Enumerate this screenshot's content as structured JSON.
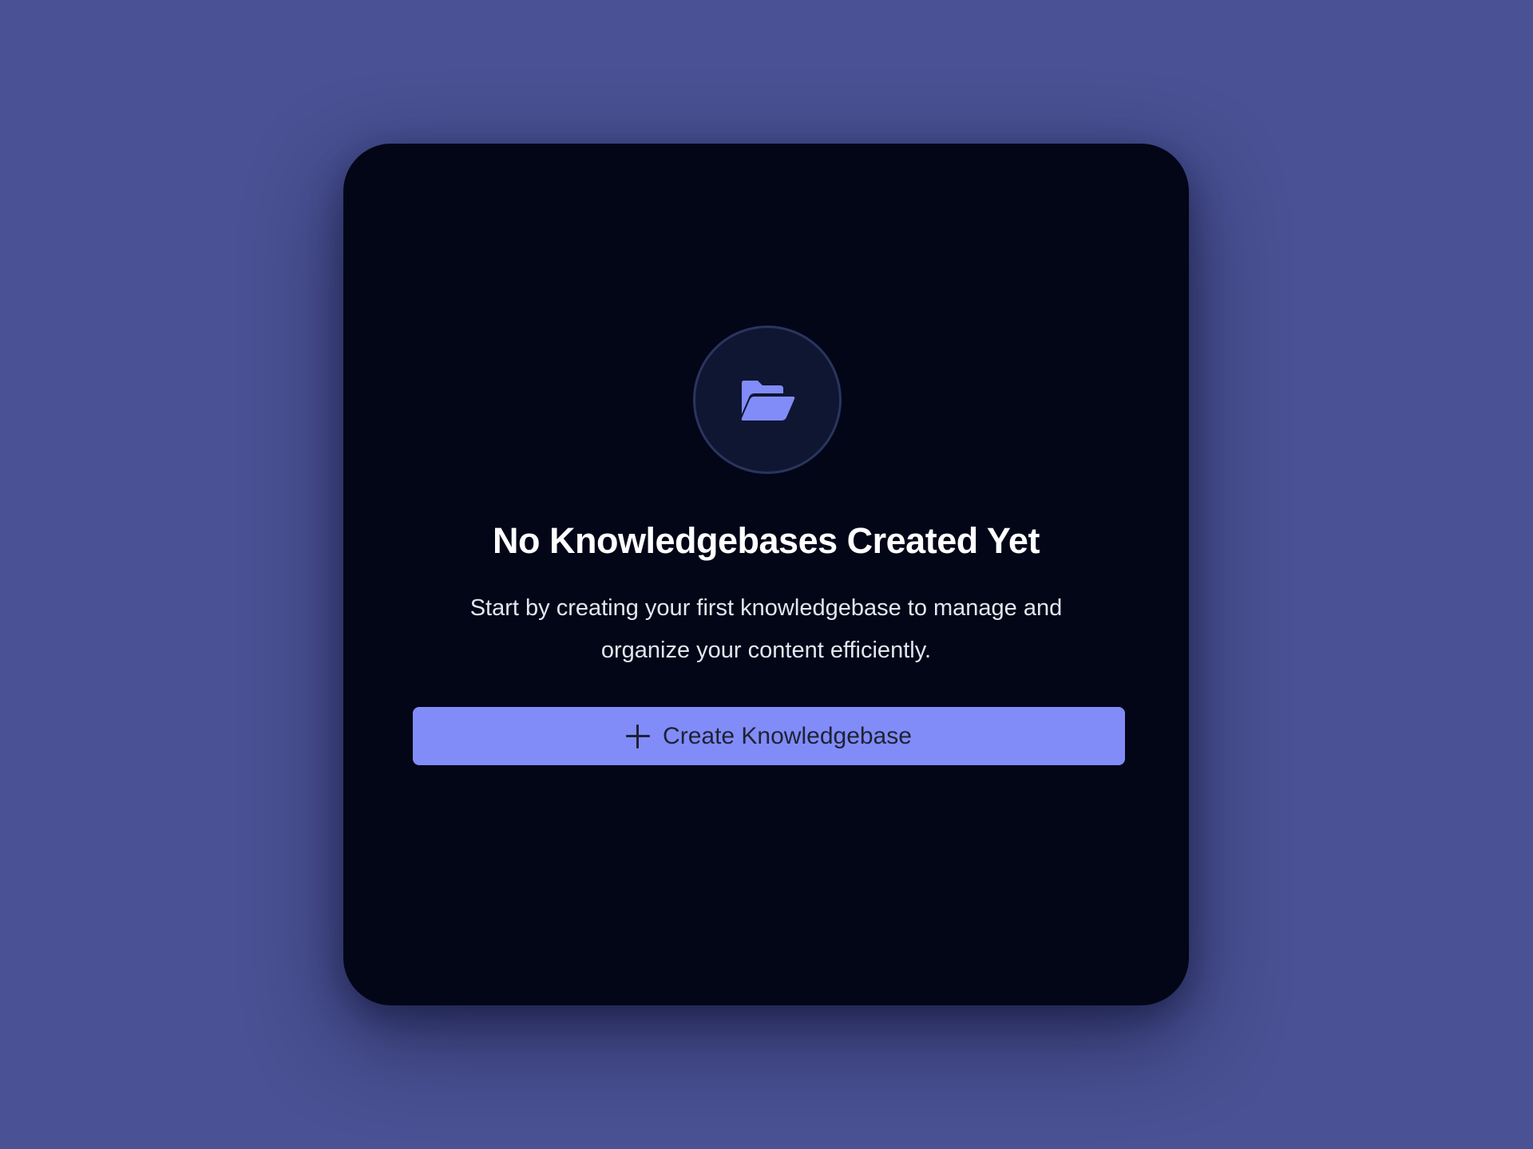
{
  "empty_state": {
    "icon": "folder-open-icon",
    "title": "No Knowledgebases Created Yet",
    "description": "Start by creating your first knowledgebase to manage and organize your content efficiently.",
    "create_button_label": "Create Knowledgebase",
    "create_button_icon": "plus-icon"
  },
  "colors": {
    "page_background": "#4a5194",
    "card_background": "#020617",
    "accent": "#818cf8",
    "icon_circle_background": "#0f1631",
    "icon_circle_border": "#2b345f"
  }
}
